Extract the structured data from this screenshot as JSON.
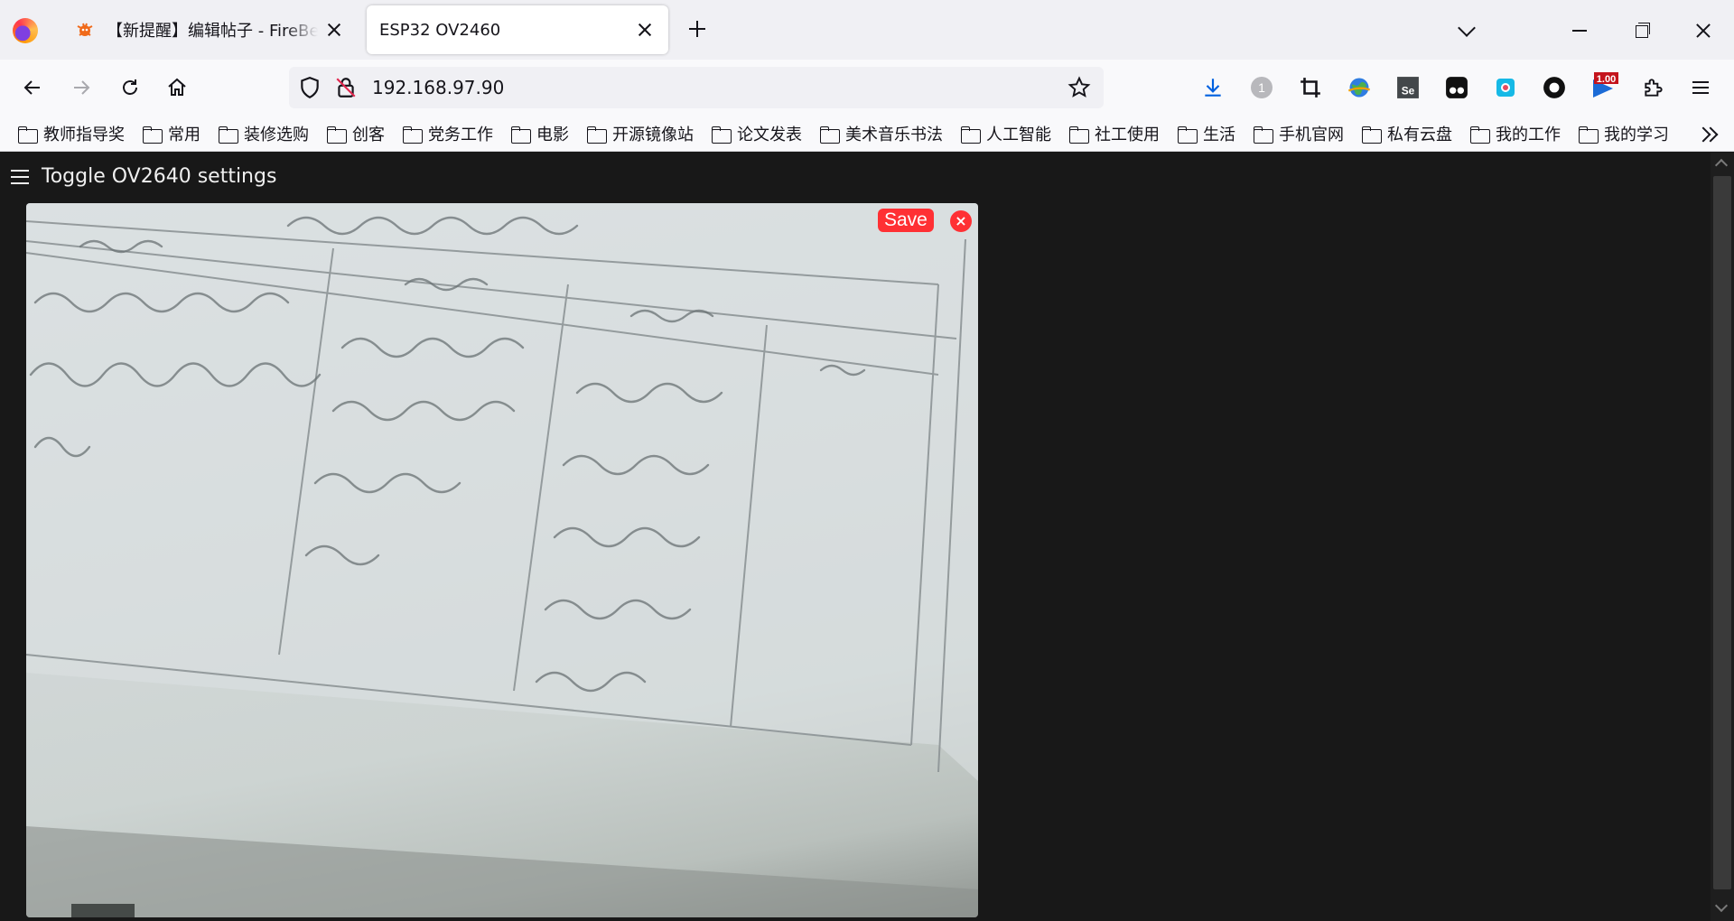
{
  "browser": {
    "tabs": [
      {
        "title": "【新提醒】编辑帖子 - FireBeetle",
        "active": false
      },
      {
        "title": "ESP32 OV2460",
        "active": true
      }
    ],
    "address": "192.168.97.90",
    "bookmarks": [
      "教师指导奖",
      "常用",
      "装修选购",
      "创客",
      "党务工作",
      "电影",
      "开源镜像站",
      "论文发表",
      "美术音乐书法",
      "人工智能",
      "社工使用",
      "生活",
      "手机官网",
      "私有云盘",
      "我的工作",
      "我的学习"
    ],
    "extensions": {
      "badge_count": "1",
      "se_label": "Se",
      "speed_badge": "1.00"
    }
  },
  "page": {
    "toggle_label": "Toggle OV2640 settings",
    "save_label": "Save",
    "close_label": "×"
  },
  "colors": {
    "accent": "#ff3034",
    "background": "#181818",
    "text": "#efefef"
  },
  "icons": {
    "back": "back-arrow-icon",
    "forward": "forward-arrow-icon",
    "reload": "reload-icon",
    "home": "home-icon",
    "shield": "shield-icon",
    "lock": "insecure-lock-icon",
    "star": "bookmark-star-icon",
    "download": "download-icon",
    "menu": "hamburger-menu-icon"
  }
}
